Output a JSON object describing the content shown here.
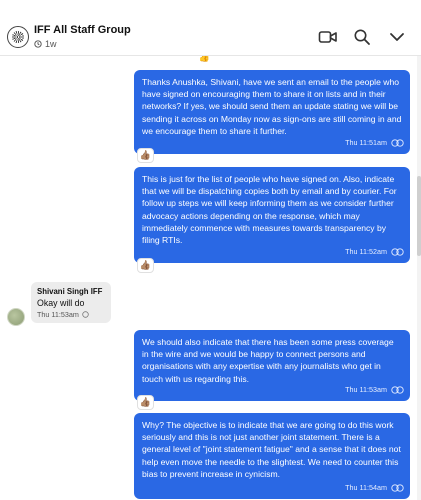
{
  "header": {
    "title": "IFF All Staff Group",
    "subtitle": "1w",
    "icons": {
      "avatar": "group-logo",
      "clock": "clock-icon",
      "video": "video-call-icon",
      "search": "search-icon",
      "chevron": "chevron-down-icon"
    }
  },
  "messages": [
    {
      "type": "outgoing",
      "text": "Thanks Anushka, Shivani, have we sent an email to the people who have signed on encouraging them to share it on lists and in their networks? If yes, we should send them an update stating we will be sending it across on Monday now as sign-ons are still coming in and we encourage them to share it further.",
      "time": "Thu 11:51am",
      "reaction": "👍🏽"
    },
    {
      "type": "outgoing",
      "text": "This is just for the list of people who have signed on. Also, indicate that we will be dispatching copies both by email and by courier. For follow up steps we will keep informing them as we consider further advocacy actions depending on the response, which may immediately commence with measures towards transparency by filing RTIs.",
      "time": "Thu 11:52am",
      "reaction": "👍🏽"
    },
    {
      "type": "incoming",
      "sender": "Shivani Singh IFF",
      "text": "Okay will do",
      "time": "Thu 11:53am"
    },
    {
      "type": "outgoing",
      "text": "We should also indicate that there has been some press coverage in the wire and we would be happy to connect persons and organisations with any expertise with any journalists who get in touch with us regarding this.",
      "time": "Thu 11:53am",
      "reaction": "👍🏽"
    },
    {
      "type": "outgoing",
      "text": "Why? The objective is to indicate that we are going to do this work seriously and this is not just another joint statement. There is a general level of \"joint statement fatigue\" and a sense that it does not help even move the needle to the slightest. We need to counter this bias to prevent increase in cynicism.",
      "time": "Thu 11:54am"
    }
  ],
  "top_reaction": "👍",
  "colors": {
    "outgoing_bubble": "#2a68e4",
    "incoming_bubble": "#ececec"
  }
}
